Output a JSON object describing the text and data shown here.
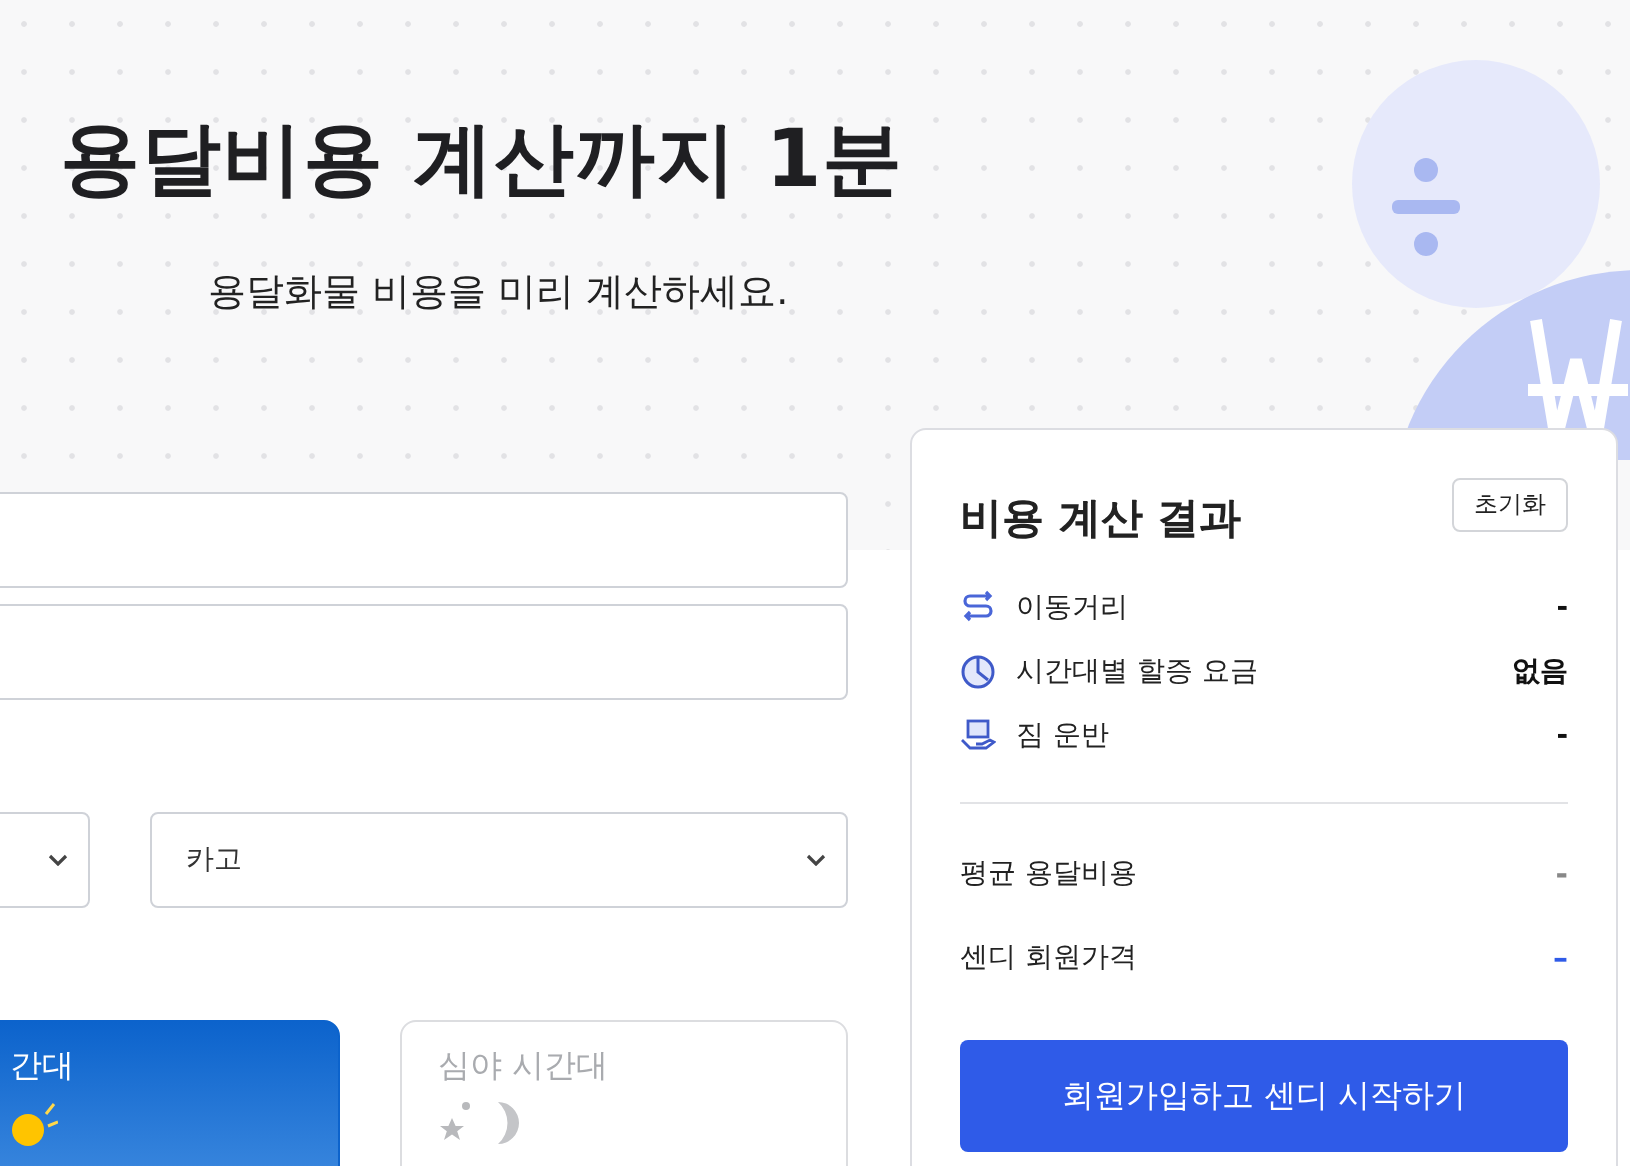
{
  "header": {
    "title": "용달비용 계산까지 1분",
    "subtitle": "용달화물 비용을 미리 계산하세요."
  },
  "vehicle_select": {
    "value": "카고"
  },
  "time_slots": [
    {
      "label": "간대",
      "selected": true
    },
    {
      "label": "심야 시간대",
      "selected": false
    }
  ],
  "result": {
    "title": "비용 계산 결과",
    "reset_button": "초기화",
    "items": [
      {
        "kind": "distance",
        "label": "이동거리",
        "value": "-"
      },
      {
        "kind": "time",
        "label": "시간대별 할증 요금",
        "value": "없음"
      },
      {
        "kind": "carry",
        "label": "짐 운반",
        "value": "-"
      }
    ],
    "summary": [
      {
        "label": "평균 용달비용",
        "value": "-",
        "emphasis": false
      },
      {
        "label": "센디 회원가격",
        "value": "–",
        "emphasis": true
      }
    ],
    "cta": "회원가입하고 센디 시작하기"
  }
}
